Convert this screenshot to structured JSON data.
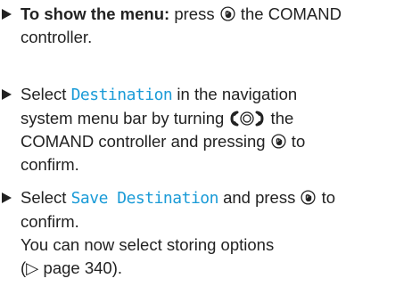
{
  "steps": [
    {
      "lines": [
        {
          "bold": "To show the menu:",
          "t1": " press ",
          "t2": " the COMAND"
        },
        {
          "text": "controller."
        }
      ]
    },
    {
      "lines": [
        {
          "t1": "Select ",
          "mono": "Destination",
          "t2": " in the navigation"
        },
        {
          "t1": "system menu bar by turning ",
          "t2": " the"
        },
        {
          "t1": "COMAND controller and pressing ",
          "t2": " to"
        },
        {
          "text": "confirm."
        }
      ]
    },
    {
      "lines": [
        {
          "t1": "Select ",
          "mono": "Save Destination",
          "t2": " and press ",
          "t3": " to"
        },
        {
          "text": "confirm."
        },
        {
          "text": "You can now select storing options"
        },
        {
          "t1": "(▷ page 340)."
        }
      ]
    }
  ],
  "icons": {
    "press": "controller-press-icon",
    "turn": "controller-turn-icon"
  },
  "colors": {
    "text": "#222222",
    "highlight": "#1a9bd7"
  }
}
